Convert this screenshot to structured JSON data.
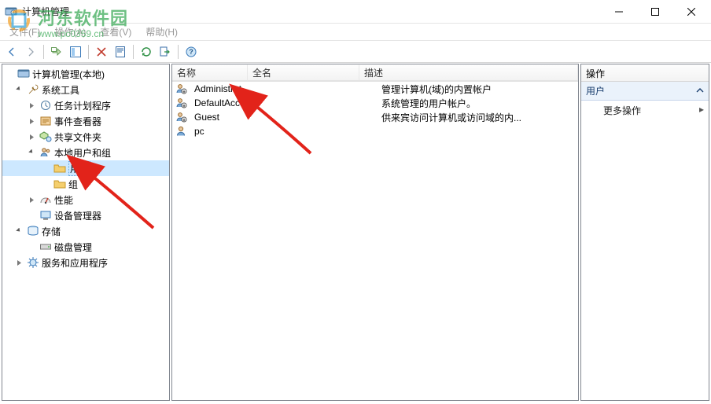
{
  "window": {
    "title": "计算机管理"
  },
  "menu": {
    "file": "文件(F)",
    "action": "操作(A)",
    "view": "查看(V)",
    "help": "帮助(H)"
  },
  "watermark": {
    "name": "河东软件园",
    "url": "www.pc0359.cn"
  },
  "tree": {
    "root": "计算机管理(本地)",
    "system_tools": "系统工具",
    "task_scheduler": "任务计划程序",
    "event_viewer": "事件查看器",
    "shared_folders": "共享文件夹",
    "local_users": "本地用户和组",
    "users_folder": "用户",
    "groups_folder": "组",
    "performance": "性能",
    "device_manager": "设备管理器",
    "storage": "存储",
    "disk_mgmt": "磁盘管理",
    "services_apps": "服务和应用程序"
  },
  "list": {
    "columns": {
      "name": "名称",
      "fullname": "全名",
      "description": "描述"
    },
    "rows": [
      {
        "name": "Administrat...",
        "fullname": "",
        "description": "管理计算机(域)的内置帐户"
      },
      {
        "name": "DefaultAcc...",
        "fullname": "",
        "description": "系统管理的用户帐户。"
      },
      {
        "name": "Guest",
        "fullname": "",
        "description": "供来宾访问计算机或访问域的内..."
      },
      {
        "name": "pc",
        "fullname": "",
        "description": ""
      }
    ]
  },
  "actions": {
    "header": "操作",
    "section": "用户",
    "more": "更多操作"
  }
}
